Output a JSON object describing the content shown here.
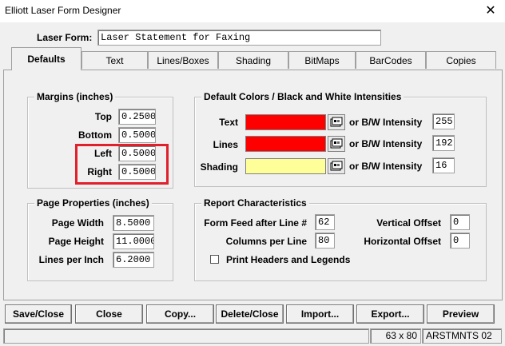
{
  "window": {
    "title": "Elliott Laser Form Designer",
    "close_glyph": "✕"
  },
  "form": {
    "label": "Laser Form:",
    "value": "Laser Statement for Faxing"
  },
  "tabs": [
    "Defaults",
    "Text",
    "Lines/Boxes",
    "Shading",
    "BitMaps",
    "BarCodes",
    "Copies"
  ],
  "margins": {
    "title": "Margins (inches)",
    "top_label": "Top",
    "top_value": "0.2500",
    "bottom_label": "Bottom",
    "bottom_value": "0.5000",
    "left_label": "Left",
    "left_value": "0.5000",
    "right_label": "Right",
    "right_value": "0.5000"
  },
  "colors": {
    "title": "Default Colors / Black and White Intensities",
    "text_label": "Text",
    "text_color": "#ff0000",
    "text_intensity_label": "or B/W Intensity",
    "text_intensity": "255",
    "lines_label": "Lines",
    "lines_color": "#ff0000",
    "lines_intensity_label": "or B/W Intensity",
    "lines_intensity": "192",
    "shading_label": "Shading",
    "shading_color": "#ffff99",
    "shading_intensity_label": "or B/W Intensity",
    "shading_intensity": "16"
  },
  "page_properties": {
    "title": "Page Properties (inches)",
    "width_label": "Page Width",
    "width_value": "8.5000",
    "height_label": "Page Height",
    "height_value": "11.0000",
    "lpi_label": "Lines per Inch",
    "lpi_value": "6.2000"
  },
  "report": {
    "title": "Report Characteristics",
    "formfeed_label": "Form Feed after Line #",
    "formfeed_value": "62",
    "columns_label": "Columns per Line",
    "columns_value": "80",
    "voffset_label": "Vertical Offset",
    "voffset_value": "0",
    "hoffset_label": "Horizontal Offset",
    "hoffset_value": "0",
    "headers_label": "Print Headers and Legends",
    "headers_checked": false
  },
  "buttons": [
    "Save/Close",
    "Close",
    "Copy...",
    "Delete/Close",
    "Import...",
    "Export...",
    "Preview"
  ],
  "status": {
    "size": "63 x 80",
    "name": "ARSTMNTS 02"
  },
  "icons": {
    "color_picker": "palette-icon",
    "close": "close-icon"
  }
}
